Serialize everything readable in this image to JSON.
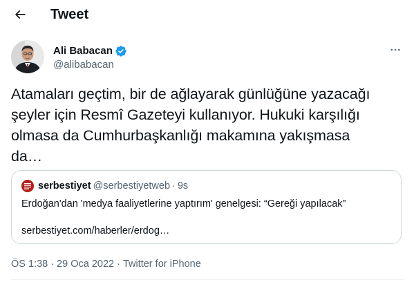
{
  "header": {
    "title": "Tweet",
    "back_icon": "arrow-left-icon"
  },
  "author": {
    "name": "Ali Babacan",
    "handle": "@alibabacan",
    "verified": true,
    "verified_color": "#1d9bf0"
  },
  "tweet": {
    "text": "Atamaları geçtim, bir de ağlayarak günlüğüne yazacağı\nşeyler için Resmî Gazeteyi kullanıyor. Hukuki karşılığı\nolmasa da Cumhurbaşkanlığı makamına yakışmasa\nda…"
  },
  "quote": {
    "name": "serbestiyet",
    "handle": "@serbestiyetweb",
    "separator": "·",
    "time": "9s",
    "text": "Erdoğan'dan 'medya faaliyetlerine yaptırım' genelgesi: “Gereği yapılacak”",
    "link": "serbestiyet.com/haberler/erdog…"
  },
  "meta": {
    "time": "ÖS 1:38",
    "separator": "·",
    "date": "29 Oca 2022",
    "source": "Twitter for iPhone"
  },
  "colors": {
    "text_primary": "#0f1419",
    "text_secondary": "#536471",
    "border": "#cfd9de",
    "accent": "#1d9bf0"
  }
}
